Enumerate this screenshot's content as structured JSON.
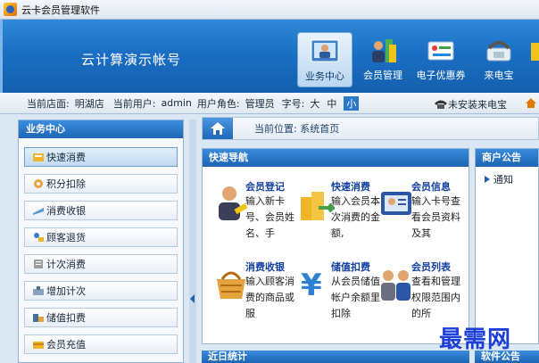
{
  "window": {
    "title": "云卡会员管理软件"
  },
  "header": {
    "account_name": "云计算演示帐号",
    "nav": [
      {
        "label": "业务中心",
        "icon": "business-center-icon",
        "active": true
      },
      {
        "label": "会员管理",
        "icon": "member-management-icon",
        "active": false
      },
      {
        "label": "电子优惠券",
        "icon": "e-coupon-icon",
        "active": false
      },
      {
        "label": "来电宝",
        "icon": "phone-icon",
        "active": false
      },
      {
        "label": "",
        "icon": "more-icon",
        "active": false
      }
    ]
  },
  "status": {
    "store_label": "当前店面:",
    "store": "明湖店",
    "user_label": "当前用户:",
    "user": "admin",
    "role_label": "用户角色:",
    "role": "管理员",
    "font_label": "字号:",
    "font_sizes": [
      "大",
      "中",
      "小"
    ],
    "font_selected": "小",
    "phone_status": "未安装来电宝"
  },
  "sidebar": {
    "title": "业务中心",
    "items": [
      {
        "label": "快速消费",
        "icon": "quick-consume-icon",
        "active": true
      },
      {
        "label": "积分扣除",
        "icon": "points-deduct-icon",
        "active": false
      },
      {
        "label": "消费收银",
        "icon": "cashier-icon",
        "active": false
      },
      {
        "label": "顾客退货",
        "icon": "customer-return-icon",
        "active": false
      },
      {
        "label": "计次消费",
        "icon": "count-consume-icon",
        "active": false
      },
      {
        "label": "增加计次",
        "icon": "add-count-icon",
        "active": false
      },
      {
        "label": "储值扣费",
        "icon": "stored-value-deduct-icon",
        "active": false
      },
      {
        "label": "会员充值",
        "icon": "member-recharge-icon",
        "active": false
      }
    ]
  },
  "breadcrumb": {
    "text": "当前位置: 系统首页"
  },
  "quick_nav": {
    "title": "快速导航",
    "items": [
      {
        "title": "会员登记",
        "desc": "输入新卡号、会员姓名、手",
        "icon": "member-register-icon"
      },
      {
        "title": "快速消费",
        "desc": "输入会员本次消费的金额,",
        "icon": "quick-consume-coins-icon"
      },
      {
        "title": "会员信息",
        "desc": "输入卡号查看会员资料及其",
        "icon": "member-info-icon"
      },
      {
        "title": "消费收银",
        "desc": "输入顾客消费的商品或服",
        "icon": "shopping-basket-icon"
      },
      {
        "title": "储值扣费",
        "desc": "从会员储值帐户余额里扣除",
        "icon": "yen-deduct-icon"
      },
      {
        "title": "会员列表",
        "desc": "查看和管理权限范围内的所",
        "icon": "member-list-icon"
      }
    ]
  },
  "notice": {
    "title": "商户公告",
    "items": [
      "通知"
    ]
  },
  "bottom": {
    "left_title": "近日统计",
    "right_title": "软件公告"
  },
  "watermark": "最需网"
}
